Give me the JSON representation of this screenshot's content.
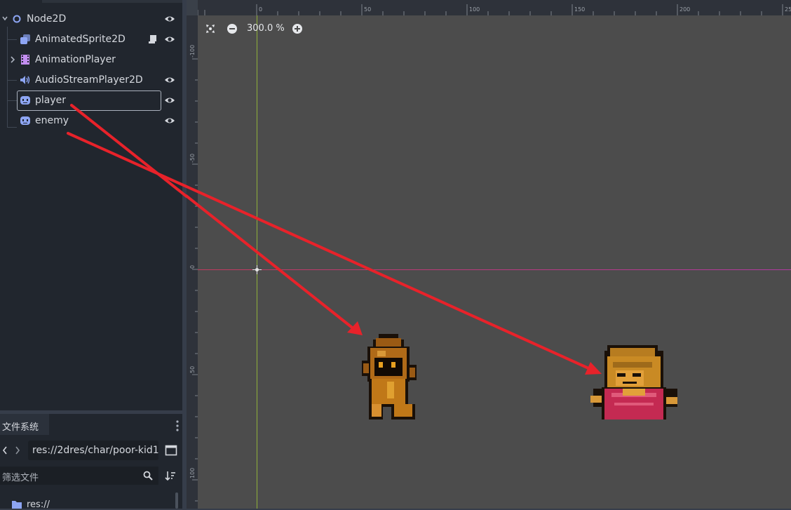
{
  "scene_tree": {
    "nodes": [
      {
        "label": "Node2D",
        "icon": "node2d-icon"
      },
      {
        "label": "AnimatedSprite2D",
        "icon": "animated-sprite-icon"
      },
      {
        "label": "AnimationPlayer",
        "icon": "animation-player-icon"
      },
      {
        "label": "AudioStreamPlayer2D",
        "icon": "audio-player-icon"
      },
      {
        "label": "player",
        "icon": "sprite-icon"
      },
      {
        "label": "enemy",
        "icon": "sprite-icon"
      }
    ]
  },
  "filesystem": {
    "tab_label": "文件系统",
    "path": "res://2dres/char/poor-kid1",
    "filter_placeholder": "筛选文件",
    "root_label": "res://"
  },
  "viewport": {
    "zoom": "300.0 %",
    "ruler_top": [
      "0",
      "50",
      "100",
      "150",
      "200",
      "25"
    ],
    "ruler_left": [
      "-100",
      "-50",
      "0",
      "50",
      "100"
    ]
  },
  "colors": {
    "annotation_arrow": "#e8222a",
    "x_axis": "#c23a5e",
    "y_axis": "#8fb13a",
    "accent": "#8da5f3"
  }
}
